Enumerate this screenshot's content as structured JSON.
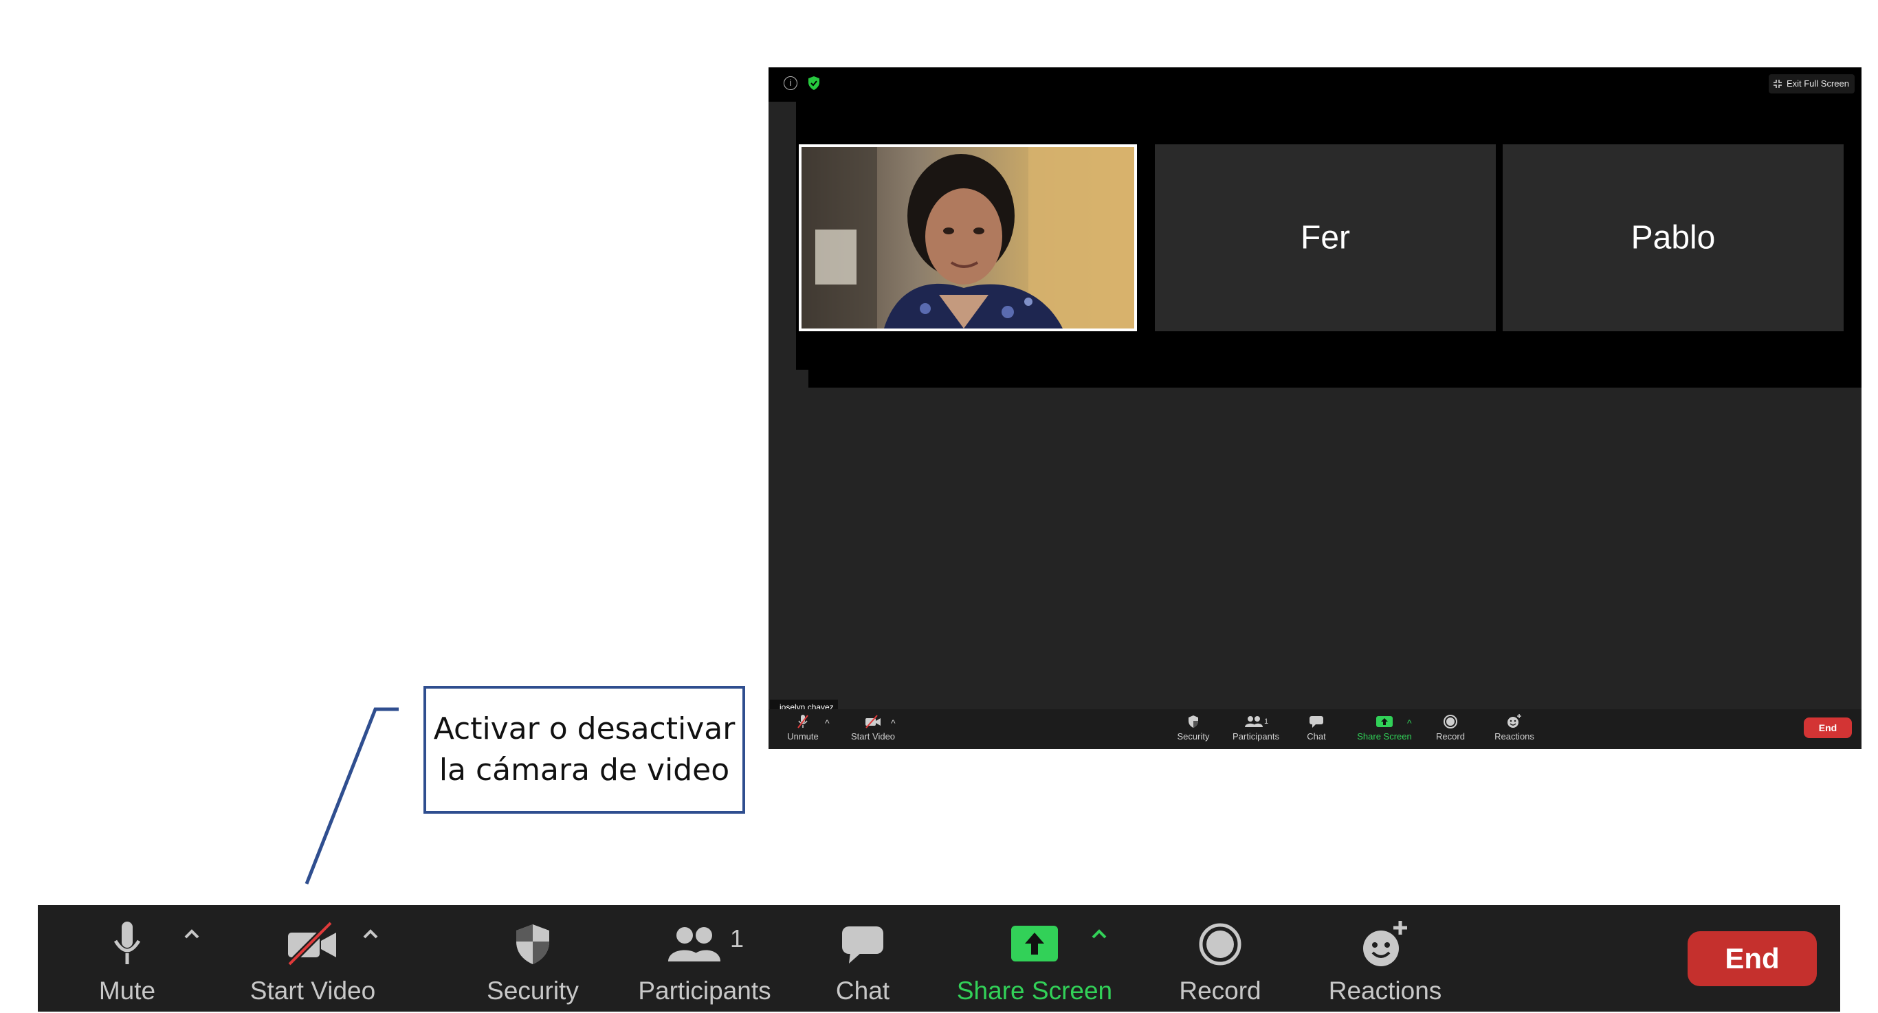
{
  "meeting_window": {
    "info_icon": "info-icon",
    "exit_full_screen": "Exit Full Screen",
    "participants": [
      {
        "name": "",
        "has_video": true
      },
      {
        "name": "Fer",
        "has_video": false
      },
      {
        "name": "Pablo",
        "has_video": false
      }
    ],
    "self_name_tag": "joselyn chavez",
    "toolbar": {
      "unmute": "Unmute",
      "start_video": "Start Video",
      "security": "Security",
      "participants": "Participants",
      "participants_count": "1",
      "chat": "Chat",
      "share_screen": "Share Screen",
      "record": "Record",
      "reactions": "Reactions",
      "end": "End"
    }
  },
  "callout": {
    "line1": "Activar o desactivar",
    "line2": "la cámara de video"
  },
  "big_toolbar": {
    "mute": "Mute",
    "start_video": "Start Video",
    "security": "Security",
    "participants": "Participants",
    "participants_count": "1",
    "chat": "Chat",
    "share_screen": "Share Screen",
    "record": "Record",
    "reactions": "Reactions",
    "end": "End"
  },
  "colors": {
    "toolbar_bg": "#1f1f1f",
    "green": "#32d158",
    "end_red": "#c5302d",
    "callout_border": "#2f4e8f"
  }
}
